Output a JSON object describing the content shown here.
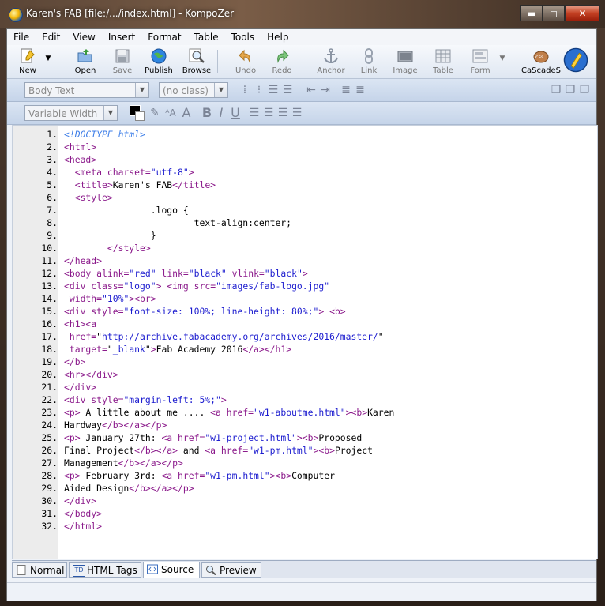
{
  "window": {
    "title": "Karen's FAB [file:/.../index.html] - KompoZer",
    "controls": {
      "minimize": "▬",
      "maximize": "◻",
      "close": "✕"
    }
  },
  "menu": [
    "File",
    "Edit",
    "View",
    "Insert",
    "Format",
    "Table",
    "Tools",
    "Help"
  ],
  "toolbar": {
    "new": "New",
    "open": "Open",
    "save": "Save",
    "publish": "Publish",
    "browse": "Browse",
    "undo": "Undo",
    "redo": "Redo",
    "anchor": "Anchor",
    "link": "Link",
    "image": "Image",
    "table": "Table",
    "form": "Form",
    "cascades": "CaScadeS"
  },
  "format1": {
    "paragraph_style": "Body Text",
    "class": "(no class)"
  },
  "format2": {
    "font": "Variable Width",
    "bold": "B",
    "italic": "I",
    "underline": "U"
  },
  "editor": {
    "lines": [
      {
        "n": "1.",
        "s": [
          [
            "cmt",
            "<!DOCTYPE html>"
          ]
        ]
      },
      {
        "n": "2.",
        "s": [
          [
            "tag",
            "<html>"
          ]
        ]
      },
      {
        "n": "3.",
        "s": [
          [
            "tag",
            "<head>"
          ]
        ]
      },
      {
        "n": "4.",
        "s": [
          [
            "ink",
            "  "
          ],
          [
            "tag",
            "<meta "
          ],
          [
            "attr",
            "charset="
          ],
          [
            "val",
            "\"utf-8\""
          ],
          [
            "tag",
            ">"
          ]
        ]
      },
      {
        "n": "5.",
        "s": [
          [
            "ink",
            "  "
          ],
          [
            "tag",
            "<title>"
          ],
          [
            "ink",
            "Karen's FAB"
          ],
          [
            "tag",
            "</title>"
          ]
        ]
      },
      {
        "n": "6.",
        "s": [
          [
            "ink",
            "  "
          ],
          [
            "tag",
            "<style>"
          ]
        ]
      },
      {
        "n": "7.",
        "s": [
          [
            "ink",
            "                .logo {"
          ]
        ]
      },
      {
        "n": "8.",
        "s": [
          [
            "ink",
            "                        text-align:center;"
          ]
        ]
      },
      {
        "n": "9.",
        "s": [
          [
            "ink",
            "                }"
          ]
        ]
      },
      {
        "n": "10.",
        "s": [
          [
            "ink",
            "        "
          ],
          [
            "tag",
            "</style>"
          ]
        ]
      },
      {
        "n": "11.",
        "s": [
          [
            "tag",
            "</head>"
          ]
        ]
      },
      {
        "n": "12.",
        "s": [
          [
            "tag",
            "<body "
          ],
          [
            "attr",
            "alink="
          ],
          [
            "val",
            "\"red\""
          ],
          [
            "attr",
            " link="
          ],
          [
            "val",
            "\"black\""
          ],
          [
            "attr",
            " vlink="
          ],
          [
            "val",
            "\"black\""
          ],
          [
            "tag",
            ">"
          ]
        ]
      },
      {
        "n": "13.",
        "s": [
          [
            "tag",
            "<div "
          ],
          [
            "attr",
            "class="
          ],
          [
            "val",
            "\"logo\""
          ],
          [
            "tag",
            ">"
          ],
          [
            "ink",
            " "
          ],
          [
            "tag",
            "<img "
          ],
          [
            "attr",
            "src="
          ],
          [
            "val",
            "\"images/fab-logo.jpg\""
          ]
        ]
      },
      {
        "n": "14.",
        "s": [
          [
            "attr",
            " width="
          ],
          [
            "val",
            "\"10%\""
          ],
          [
            "tag",
            "><br>"
          ]
        ]
      },
      {
        "n": "15.",
        "s": [
          [
            "tag",
            "<div "
          ],
          [
            "attr",
            "style="
          ],
          [
            "val",
            "\"font-size: 100%; line-height: 80%;\""
          ],
          [
            "tag",
            ">"
          ],
          [
            "ink",
            " "
          ],
          [
            "tag",
            "<b>"
          ]
        ]
      },
      {
        "n": "16.",
        "s": [
          [
            "tag",
            "<h1><a"
          ]
        ]
      },
      {
        "n": "17.",
        "s": [
          [
            "attr",
            " href="
          ],
          [
            "ink",
            "\""
          ],
          [
            "val",
            "http://archive.fabacademy.org/archives/2016/master/"
          ],
          [
            "ink",
            "\""
          ]
        ]
      },
      {
        "n": "18.",
        "s": [
          [
            "attr",
            " target="
          ],
          [
            "ink",
            "\""
          ],
          [
            "val",
            "_blank"
          ],
          [
            "ink",
            "\""
          ],
          [
            "tag",
            ">"
          ],
          [
            "ink",
            "Fab Academy 2016"
          ],
          [
            "tag",
            "</a></h1>"
          ]
        ]
      },
      {
        "n": "19.",
        "s": [
          [
            "tag",
            "</b>"
          ]
        ]
      },
      {
        "n": "20.",
        "s": [
          [
            "tag",
            "<hr></div>"
          ]
        ]
      },
      {
        "n": "21.",
        "s": [
          [
            "tag",
            "</div>"
          ]
        ]
      },
      {
        "n": "22.",
        "s": [
          [
            "tag",
            "<div "
          ],
          [
            "attr",
            "style="
          ],
          [
            "val",
            "\"margin-left: 5%;\""
          ],
          [
            "tag",
            ">"
          ]
        ]
      },
      {
        "n": "23.",
        "s": [
          [
            "tag",
            "<p>"
          ],
          [
            "ink",
            " A little about me .... "
          ],
          [
            "tag",
            "<a "
          ],
          [
            "attr",
            "href="
          ],
          [
            "val",
            "\"w1-aboutme.html\""
          ],
          [
            "tag",
            "><b>"
          ],
          [
            "ink",
            "Karen"
          ]
        ]
      },
      {
        "n": "24.",
        "s": [
          [
            "ink",
            "Hardway"
          ],
          [
            "tag",
            "</b></a></p>"
          ]
        ]
      },
      {
        "n": "25.",
        "s": [
          [
            "tag",
            "<p>"
          ],
          [
            "ink",
            " January 27th: "
          ],
          [
            "tag",
            "<a "
          ],
          [
            "attr",
            "href="
          ],
          [
            "val",
            "\"w1-project.html\""
          ],
          [
            "tag",
            "><b>"
          ],
          [
            "ink",
            "Proposed"
          ]
        ]
      },
      {
        "n": "26.",
        "s": [
          [
            "ink",
            "Final Project"
          ],
          [
            "tag",
            "</b></a>"
          ],
          [
            "ink",
            " and "
          ],
          [
            "tag",
            "<a "
          ],
          [
            "attr",
            "href="
          ],
          [
            "val",
            "\"w1-pm.html\""
          ],
          [
            "tag",
            "><b>"
          ],
          [
            "ink",
            "Project"
          ]
        ]
      },
      {
        "n": "27.",
        "s": [
          [
            "ink",
            "Management"
          ],
          [
            "tag",
            "</b></a></p>"
          ]
        ]
      },
      {
        "n": "28.",
        "s": [
          [
            "tag",
            "<p>"
          ],
          [
            "ink",
            " February 3rd: "
          ],
          [
            "tag",
            "<a "
          ],
          [
            "attr",
            "href="
          ],
          [
            "val",
            "\"w1-pm.html\""
          ],
          [
            "tag",
            "><b>"
          ],
          [
            "ink",
            "Computer"
          ]
        ]
      },
      {
        "n": "29.",
        "s": [
          [
            "ink",
            "Aided Design"
          ],
          [
            "tag",
            "</b></a></p>"
          ]
        ]
      },
      {
        "n": "30.",
        "s": [
          [
            "tag",
            "</div>"
          ]
        ]
      },
      {
        "n": "31.",
        "s": [
          [
            "tag",
            "</body>"
          ]
        ]
      },
      {
        "n": "32.",
        "s": [
          [
            "tag",
            "</html>"
          ]
        ]
      }
    ]
  },
  "tabs": {
    "normal": "Normal",
    "html_tags": "HTML Tags",
    "source": "Source",
    "preview": "Preview",
    "html_tags_icon_text": "TD"
  }
}
